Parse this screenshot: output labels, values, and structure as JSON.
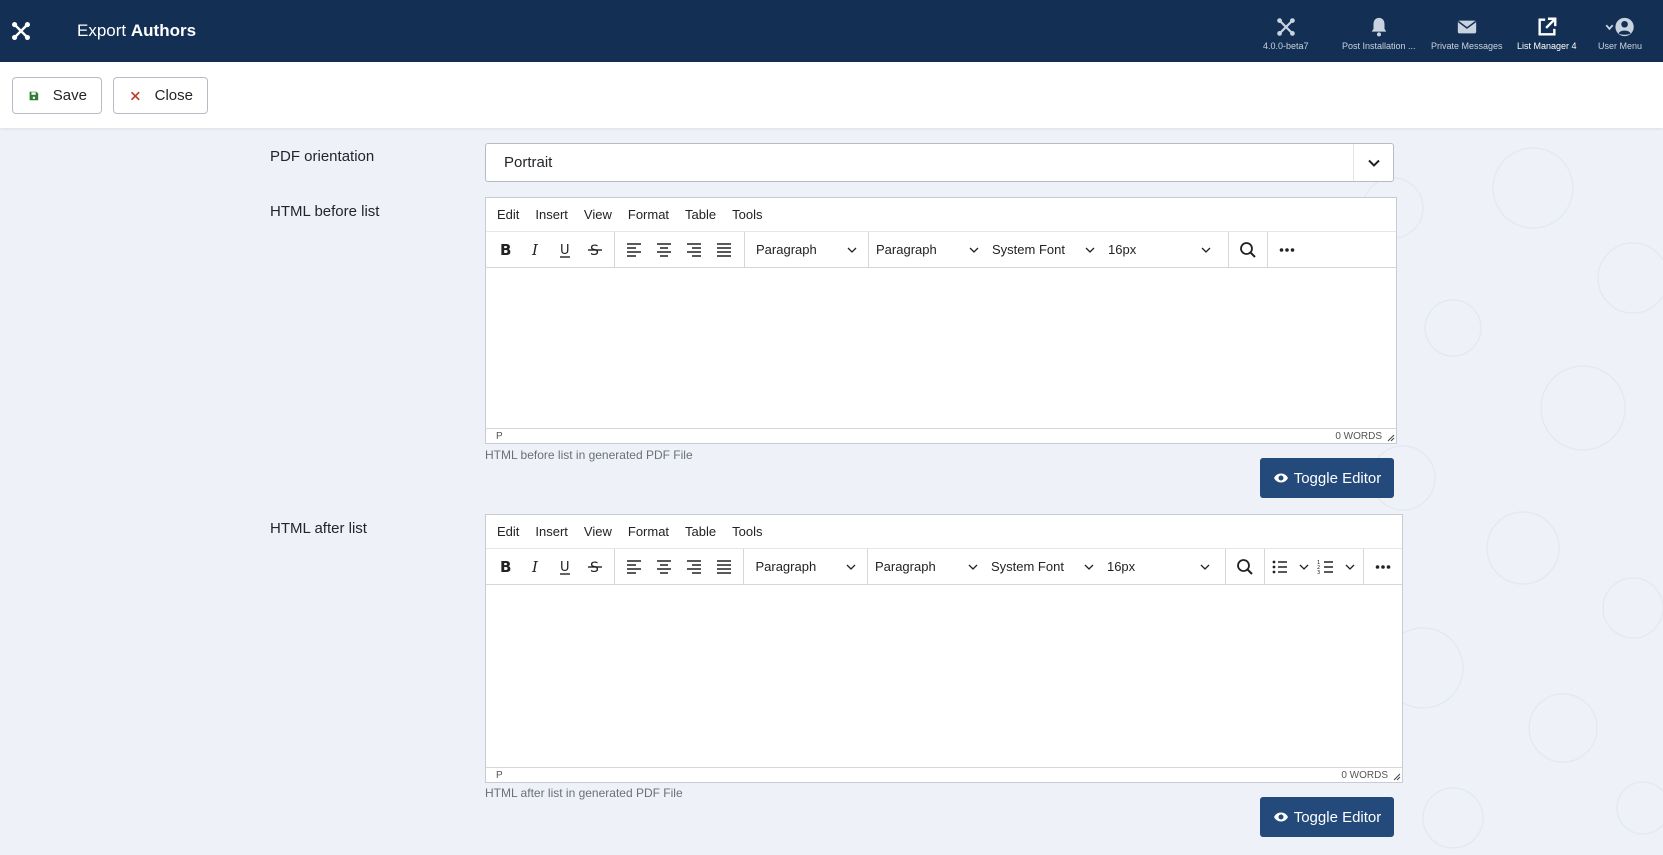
{
  "header": {
    "title_prefix": "Export",
    "title_main": "Authors",
    "items": [
      {
        "label": "4.0.0-beta7",
        "icon": "joomla-icon"
      },
      {
        "label": "Post Installation ...",
        "icon": "bell-icon"
      },
      {
        "label": "Private Messages",
        "icon": "envelope-icon"
      },
      {
        "label": "List Manager 4",
        "icon": "external-link-icon"
      },
      {
        "label": "User Menu",
        "icon": "user-circle-icon"
      }
    ]
  },
  "toolbar": {
    "save_label": "Save",
    "close_label": "Close"
  },
  "form": {
    "orientation_label": "PDF orientation",
    "orientation_value": "Portrait",
    "before": {
      "label": "HTML before list",
      "help": "HTML before list in generated PDF File",
      "path": "P",
      "words": "0 WORDS",
      "toggle": "Toggle Editor"
    },
    "after": {
      "label": "HTML after list",
      "help": "HTML after list in generated PDF File",
      "path": "P",
      "words": "0 WORDS",
      "toggle": "Toggle Editor"
    }
  },
  "editor": {
    "menu": [
      "Edit",
      "Insert",
      "View",
      "Format",
      "Table",
      "Tools"
    ],
    "block_format": "Paragraph",
    "style_format": "Paragraph",
    "font_family": "System Font",
    "font_size": "16px"
  },
  "colors": {
    "header_bg": "#132f53",
    "toggle_bg": "#234a7a",
    "save_icon": "#2f7d32",
    "close_icon": "#c0392b"
  }
}
